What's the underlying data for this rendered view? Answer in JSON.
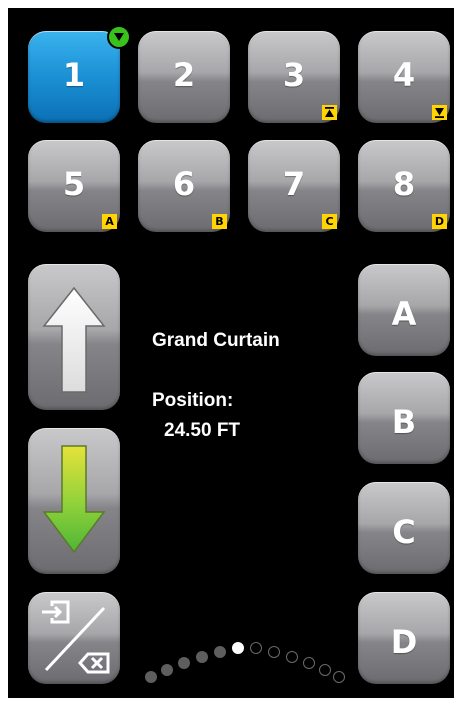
{
  "presets": [
    {
      "label": "1",
      "active": true,
      "tag": null
    },
    {
      "label": "2",
      "active": false,
      "tag": null
    },
    {
      "label": "3",
      "active": false,
      "tag": "up-limit"
    },
    {
      "label": "4",
      "active": false,
      "tag": "down-limit"
    },
    {
      "label": "5",
      "active": false,
      "tag": "A"
    },
    {
      "label": "6",
      "active": false,
      "tag": "B"
    },
    {
      "label": "7",
      "active": false,
      "tag": "C"
    },
    {
      "label": "8",
      "active": false,
      "tag": "D"
    }
  ],
  "groups": [
    "A",
    "B",
    "C",
    "D"
  ],
  "status": {
    "name": "Grand Curtain",
    "position_label": "Position:",
    "position_value": "24.50 FT"
  },
  "position_indicator": {
    "filled": 5,
    "current": 1,
    "empty": 6
  },
  "icons": {
    "selected_badge": "check-down-arrow-icon",
    "up_button": "up-arrow-icon",
    "down_button": "down-arrow-icon",
    "edit_button": "enter-backspace-icon"
  },
  "colors": {
    "active_blue": "#1b90d4",
    "check_green": "#38c21b",
    "tag_yellow": "#ffd400",
    "arrow_green": "#6cc23a"
  }
}
